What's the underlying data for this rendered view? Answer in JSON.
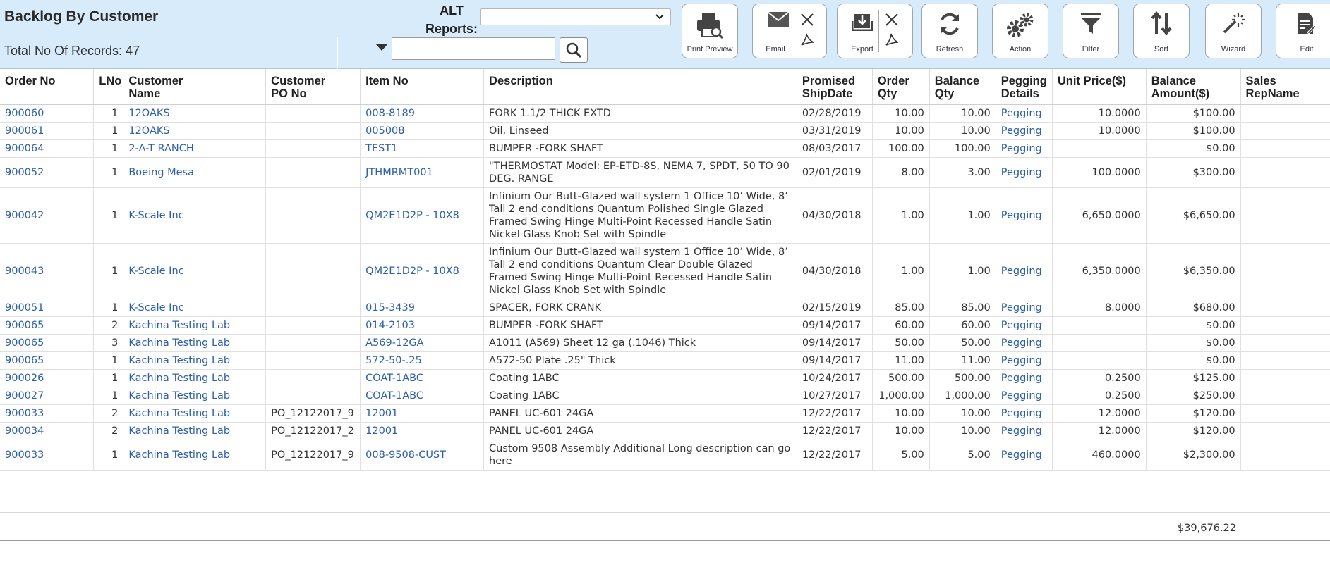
{
  "page": {
    "title": "Backlog By Customer",
    "record_count": "Total No Of Records: 47"
  },
  "alt_reports": {
    "label_line1": "ALT",
    "label_line2": "Reports:",
    "selected": ""
  },
  "search": {
    "value": ""
  },
  "toolbar": {
    "print_preview": "Print Preview",
    "email": "Email",
    "export": "Export",
    "refresh": "Refresh",
    "action": "Action",
    "filter": "Filter",
    "sort": "Sort",
    "wizard": "Wizard",
    "edit": "Edit"
  },
  "icons": [
    "printer-icon",
    "envelope-icon",
    "excel-icon",
    "pdf-icon",
    "download-icon",
    "refresh-icon",
    "gears-icon",
    "filter-icon",
    "sort-icon",
    "wand-icon",
    "edit-document-icon",
    "search-icon",
    "chevron-down-icon",
    "caret-down-icon"
  ],
  "colors": {
    "header_bg": "#d7ebfb",
    "link": "#2d5fa6"
  },
  "table": {
    "columns": {
      "order_no": "Order No",
      "lno": "LNo",
      "customer_name_1": "Customer",
      "customer_name_2": "Name",
      "customer_po_1": "Customer",
      "customer_po_2": "PO No",
      "item_no": "Item No",
      "description": "Description",
      "ship_1": "Promised",
      "ship_2": "ShipDate",
      "oqty_1": "Order",
      "oqty_2": "Qty",
      "bqty_1": "Balance",
      "bqty_2": "Qty",
      "peg_1": "Pegging",
      "peg_2": "Details",
      "unit_price": "Unit Price($)",
      "bamt_1": "Balance",
      "bamt_2": "Amount($)",
      "rep_1": "Sales",
      "rep_2": "RepName"
    },
    "rows": [
      {
        "order": "900060",
        "ln": "1",
        "cust": "12OAKS",
        "po": "",
        "item": "008-8189",
        "desc": "FORK 1.1/2 THICK EXTD",
        "ship": "02/28/2019",
        "oqty": "10.00",
        "bqty": "10.00",
        "peg": "Pegging",
        "price": "10.0000",
        "amt": "$100.00",
        "rep": ""
      },
      {
        "order": "900061",
        "ln": "1",
        "cust": "12OAKS",
        "po": "",
        "item": "005008",
        "desc": "Oil, Linseed",
        "ship": "03/31/2019",
        "oqty": "10.00",
        "bqty": "10.00",
        "peg": "Pegging",
        "price": "10.0000",
        "amt": "$100.00",
        "rep": ""
      },
      {
        "order": "900064",
        "ln": "1",
        "cust": "2-A-T RANCH",
        "po": "",
        "item": "TEST1",
        "desc": "BUMPER -FORK SHAFT",
        "ship": "08/03/2017",
        "oqty": "100.00",
        "bqty": "100.00",
        "peg": "Pegging",
        "price": "",
        "amt": "$0.00",
        "rep": ""
      },
      {
        "order": "900052",
        "ln": "1",
        "cust": "Boeing Mesa",
        "po": "",
        "item": "JTHMRMT001",
        "desc": "\"THERMOSTAT Model: EP-ETD-8S, NEMA 7, SPDT, 50 TO 90 DEG. RANGE",
        "ship": "02/01/2019",
        "oqty": "8.00",
        "bqty": "3.00",
        "peg": "Pegging",
        "price": "100.0000",
        "amt": "$300.00",
        "rep": ""
      },
      {
        "order": "900042",
        "ln": "1",
        "cust": "K-Scale Inc",
        "po": "",
        "item": "QM2E1D2P - 10X8",
        "desc": "Infinium Our Butt-Glazed wall system 1 Office 10’ Wide, 8’ Tall 2 end conditions Quantum Polished Single Glazed Framed Swing Hinge Multi-Point Recessed Handle Satin Nickel Glass Knob Set with Spindle",
        "ship": "04/30/2018",
        "oqty": "1.00",
        "bqty": "1.00",
        "peg": "Pegging",
        "price": "6,650.0000",
        "amt": "$6,650.00",
        "rep": ""
      },
      {
        "order": "900043",
        "ln": "1",
        "cust": "K-Scale Inc",
        "po": "",
        "item": "QM2E1D2P - 10X8",
        "desc": "Infinium Our Butt-Glazed wall system 1 Office 10’ Wide, 8’ Tall 2 end conditions Quantum Clear Double Glazed Framed Swing Hinge Multi-Point Recessed Handle Satin Nickel Glass Knob Set with Spindle",
        "ship": "04/30/2018",
        "oqty": "1.00",
        "bqty": "1.00",
        "peg": "Pegging",
        "price": "6,350.0000",
        "amt": "$6,350.00",
        "rep": ""
      },
      {
        "order": "900051",
        "ln": "1",
        "cust": "K-Scale Inc",
        "po": "",
        "item": "015-3439",
        "desc": "SPACER, FORK CRANK",
        "ship": "02/15/2019",
        "oqty": "85.00",
        "bqty": "85.00",
        "peg": "Pegging",
        "price": "8.0000",
        "amt": "$680.00",
        "rep": ""
      },
      {
        "order": "900065",
        "ln": "2",
        "cust": "Kachina Testing Lab",
        "po": "",
        "item": "014-2103",
        "desc": "BUMPER -FORK SHAFT",
        "ship": "09/14/2017",
        "oqty": "60.00",
        "bqty": "60.00",
        "peg": "Pegging",
        "price": "",
        "amt": "$0.00",
        "rep": ""
      },
      {
        "order": "900065",
        "ln": "3",
        "cust": "Kachina Testing Lab",
        "po": "",
        "item": "A569-12GA",
        "desc": "A1011 (A569) Sheet 12 ga (.1046) Thick",
        "ship": "09/14/2017",
        "oqty": "50.00",
        "bqty": "50.00",
        "peg": "Pegging",
        "price": "",
        "amt": "$0.00",
        "rep": ""
      },
      {
        "order": "900065",
        "ln": "1",
        "cust": "Kachina Testing Lab",
        "po": "",
        "item": "572-50-.25",
        "desc": "A572-50 Plate .25\" Thick",
        "ship": "09/14/2017",
        "oqty": "11.00",
        "bqty": "11.00",
        "peg": "Pegging",
        "price": "",
        "amt": "$0.00",
        "rep": ""
      },
      {
        "order": "900026",
        "ln": "1",
        "cust": "Kachina Testing Lab",
        "po": "",
        "item": "COAT-1ABC",
        "desc": "Coating 1ABC",
        "ship": "10/24/2017",
        "oqty": "500.00",
        "bqty": "500.00",
        "peg": "Pegging",
        "price": "0.2500",
        "amt": "$125.00",
        "rep": ""
      },
      {
        "order": "900027",
        "ln": "1",
        "cust": "Kachina Testing Lab",
        "po": "",
        "item": "COAT-1ABC",
        "desc": "Coating 1ABC",
        "ship": "10/27/2017",
        "oqty": "1,000.00",
        "bqty": "1,000.00",
        "peg": "Pegging",
        "price": "0.2500",
        "amt": "$250.00",
        "rep": ""
      },
      {
        "order": "900033",
        "ln": "2",
        "cust": "Kachina Testing Lab",
        "po": "PO_12122017_9",
        "item": "12001",
        "desc": "PANEL UC-601 24GA",
        "ship": "12/22/2017",
        "oqty": "10.00",
        "bqty": "10.00",
        "peg": "Pegging",
        "price": "12.0000",
        "amt": "$120.00",
        "rep": ""
      },
      {
        "order": "900034",
        "ln": "2",
        "cust": "Kachina Testing Lab",
        "po": "PO_12122017_2",
        "item": "12001",
        "desc": "PANEL UC-601 24GA",
        "ship": "12/22/2017",
        "oqty": "10.00",
        "bqty": "10.00",
        "peg": "Pegging",
        "price": "12.0000",
        "amt": "$120.00",
        "rep": ""
      },
      {
        "order": "900033",
        "ln": "1",
        "cust": "Kachina Testing Lab",
        "po": "PO_12122017_9",
        "item": "008-9508-CUST",
        "desc": "Custom 9508 Assembly Additional Long description can go here",
        "ship": "12/22/2017",
        "oqty": "5.00",
        "bqty": "5.00",
        "peg": "Pegging",
        "price": "460.0000",
        "amt": "$2,300.00",
        "rep": ""
      }
    ],
    "total_balance_amount": "$39,676.22"
  }
}
